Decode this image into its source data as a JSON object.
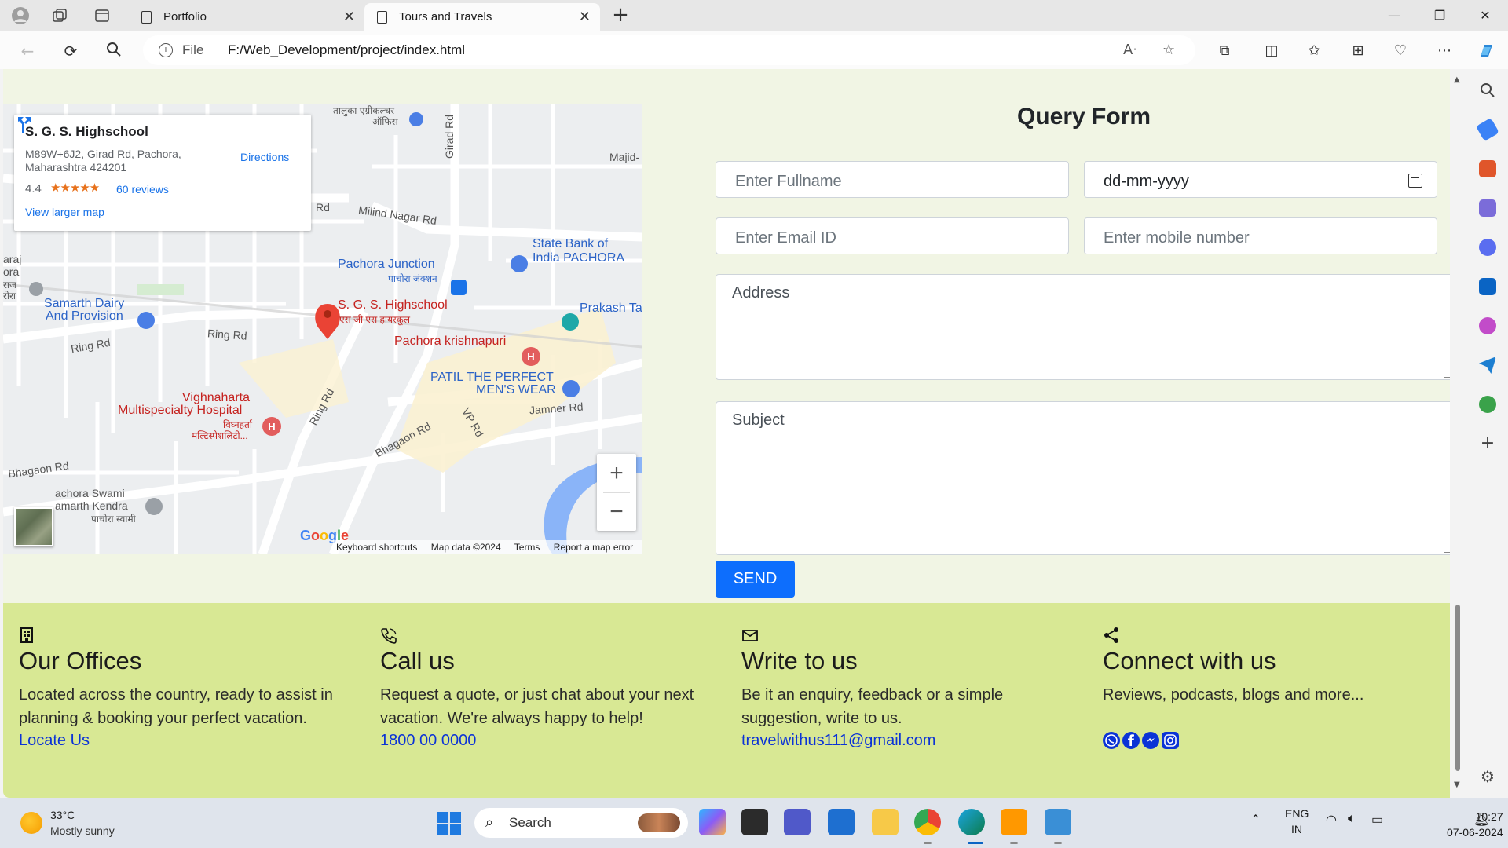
{
  "browser": {
    "tabs": [
      {
        "title": "Portfolio"
      },
      {
        "title": "Tours and Travels"
      }
    ],
    "address": {
      "scheme_label": "File",
      "url": "F:/Web_Development/project/index.html"
    }
  },
  "map": {
    "place_name": "S. G. S. Highschool",
    "address": "M89W+6J2, Girad Rd, Pachora, Maharashtra 424201",
    "rating": "4.4",
    "stars": "★★★★★",
    "reviews": "60 reviews",
    "directions": "Directions",
    "view_larger": "View larger map",
    "labels": {
      "taluka": "तालुका एग्रीकल्चर",
      "taluka2": "ऑफिस",
      "majid": "Majid-",
      "rd1": "Rd",
      "milind": "Milind Nagar Rd",
      "girad": "Girad Rd",
      "sbi1": "State Bank of",
      "sbi2": "India PACHORA",
      "junction": "Pachora Junction",
      "junction_hi": "पाचोरा जंक्शन",
      "raj1": "araj",
      "raj2": "ora",
      "raj3": "राज",
      "raj4": "रोरा",
      "samarth1": "Samarth Dairy",
      "samarth2": "And Provision",
      "sgs": "S. G. S. Highschool",
      "sgs_hi": "एस जी एस हायस्कूल",
      "prakash": "Prakash Ta",
      "ringrd1": "Ring Rd",
      "ringrd2": "Ring Rd",
      "ringrd3": "Ring Rd",
      "krishnapuri": "Pachora krishnapuri",
      "patil1": "PATIL THE PERFECT",
      "patil2": "MEN'S WEAR",
      "jamner": "Jamner Rd",
      "vprd": "VP Rd",
      "bhagaon1": "Bhagaon Rd",
      "bhagaon2": "Bhagaon Rd",
      "vighna1": "Vighnaharta",
      "vighna2": "Multispecialty Hospital",
      "vighna3": "विघ्नहर्ता",
      "vighna4": "मल्टिस्पेशलिटी...",
      "swami1": "achora Swami",
      "swami2": "amarth Kendra",
      "swami3": "पाचोरा स्वामी"
    },
    "google": "Google",
    "footer": [
      "Keyboard shortcuts",
      "Map data ©2024",
      "Terms",
      "Report a map error"
    ]
  },
  "form": {
    "title": "Query Form",
    "fullname_placeholder": "Enter Fullname",
    "date_placeholder": "dd-mm-yyyy",
    "email_placeholder": "Enter Email ID",
    "mobile_placeholder": "Enter mobile number",
    "address_placeholder": "Address",
    "subject_placeholder": "Subject",
    "send_label": "SEND"
  },
  "footer": {
    "columns": [
      {
        "icon": "building-icon",
        "title": "Our Offices",
        "text": "Located across the country, ready to assist in planning & booking your perfect vacation.",
        "link": "Locate Us"
      },
      {
        "icon": "phone-icon",
        "title": "Call us",
        "text": "Request a quote, or just chat about your next vacation. We're always happy to help!",
        "link": "1800 00 0000"
      },
      {
        "icon": "envelope-icon",
        "title": "Write to us",
        "text": "Be it an enquiry, feedback or a simple suggestion, write to us.",
        "link": "travelwithus111@gmail.com"
      },
      {
        "icon": "share-icon",
        "title": "Connect with us",
        "text": "Reviews, podcasts, blogs and more...",
        "social": [
          "whatsapp-icon",
          "facebook-icon",
          "messenger-icon",
          "instagram-icon"
        ]
      }
    ],
    "link_color": "#0b33d6",
    "background": "#d8e894"
  },
  "taskbar": {
    "weather_temp": "33°C",
    "weather_desc": "Mostly sunny",
    "search_label": "Search",
    "lang1": "ENG",
    "lang2": "IN",
    "time": "10:27",
    "date": "07-06-2024"
  }
}
